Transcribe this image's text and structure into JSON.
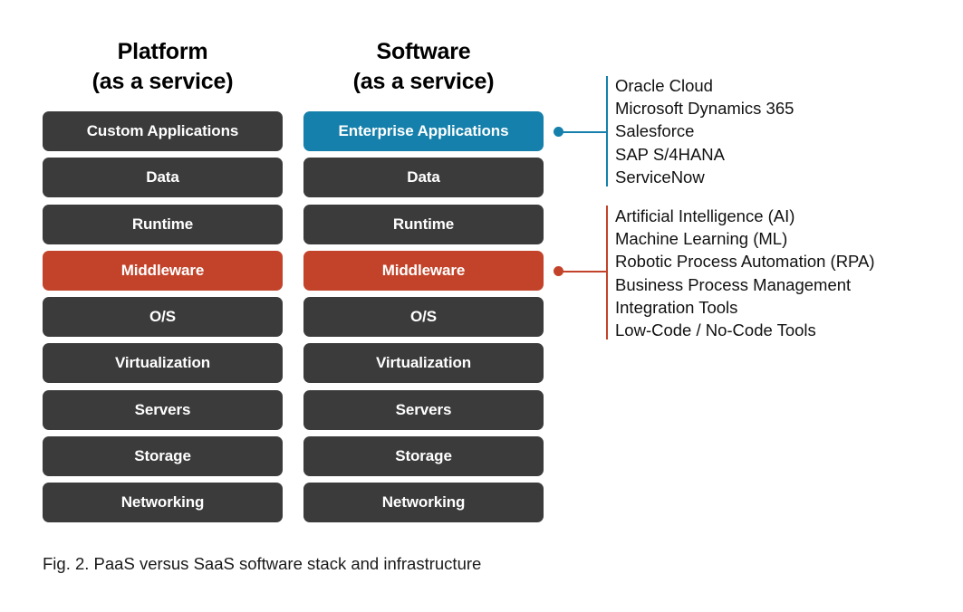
{
  "figure": {
    "caption": "Fig. 2. PaaS versus SaaS software stack and infrastructure"
  },
  "colors": {
    "dark": "#3b3b3b",
    "red": "#c2432a",
    "blue": "#1580ab",
    "background": "#ffffff",
    "text": "#111111"
  },
  "columns": [
    {
      "id": "paas",
      "title_line1": "Platform",
      "title_line2": "(as a service)",
      "layers": [
        {
          "label": "Custom Applications",
          "style": "dark"
        },
        {
          "label": "Data",
          "style": "dark"
        },
        {
          "label": "Runtime",
          "style": "dark"
        },
        {
          "label": "Middleware",
          "style": "red"
        },
        {
          "label": "O/S",
          "style": "dark"
        },
        {
          "label": "Virtualization",
          "style": "dark"
        },
        {
          "label": "Servers",
          "style": "dark"
        },
        {
          "label": "Storage",
          "style": "dark"
        },
        {
          "label": "Networking",
          "style": "dark"
        }
      ]
    },
    {
      "id": "saas",
      "title_line1": "Software",
      "title_line2": "(as a service)",
      "layers": [
        {
          "label": "Enterprise Applications",
          "style": "blue"
        },
        {
          "label": "Data",
          "style": "dark"
        },
        {
          "label": "Runtime",
          "style": "dark"
        },
        {
          "label": "Middleware",
          "style": "red"
        },
        {
          "label": "O/S",
          "style": "dark"
        },
        {
          "label": "Virtualization",
          "style": "dark"
        },
        {
          "label": "Servers",
          "style": "dark"
        },
        {
          "label": "Storage",
          "style": "dark"
        },
        {
          "label": "Networking",
          "style": "dark"
        }
      ]
    }
  ],
  "annotations": [
    {
      "id": "enterprise-applications",
      "target_layer": "Enterprise Applications",
      "color": "#1580ab",
      "items": [
        "Oracle Cloud",
        "Microsoft Dynamics 365",
        "Salesforce",
        "SAP S/4HANA",
        "ServiceNow"
      ]
    },
    {
      "id": "middleware",
      "target_layer": "Middleware",
      "color": "#c2432a",
      "items": [
        "Artificial Intelligence (AI)",
        "Machine Learning (ML)",
        "Robotic Process Automation (RPA)",
        "Business Process Management",
        "Integration Tools",
        "Low-Code / No-Code Tools"
      ]
    }
  ]
}
